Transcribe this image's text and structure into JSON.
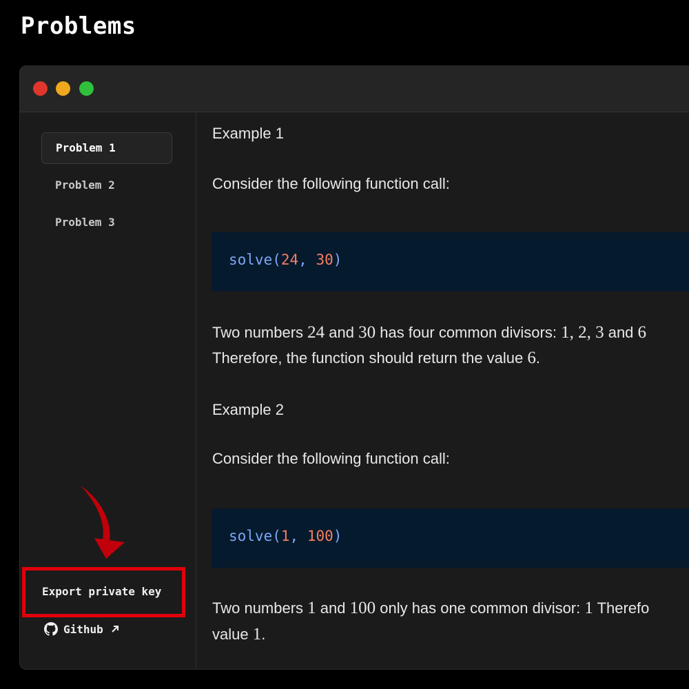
{
  "page": {
    "title": "Problems"
  },
  "sidebar": {
    "items": [
      {
        "label": "Problem 1",
        "active": true
      },
      {
        "label": "Problem 2",
        "active": false
      },
      {
        "label": "Problem 3",
        "active": false
      }
    ],
    "export_label": "Export private key",
    "github_label": "Github"
  },
  "content": {
    "example1": {
      "heading": "Example 1",
      "intro": "Consider the following function call:",
      "code": {
        "fn": "solve",
        "open": "(",
        "arg1": "24",
        "sep": ", ",
        "arg2": "30",
        "close": ")"
      },
      "line1": {
        "a": "Two numbers ",
        "n1": "24",
        "b": " and ",
        "n2": "30",
        "c": " has four common divisors: ",
        "d1": "1",
        "s1": ", ",
        "d2": "2",
        "s2": ", ",
        "d3": "3",
        "e": " and ",
        "d4": "6"
      },
      "line2": {
        "a": "Therefore, the function should return the value ",
        "v": "6",
        "end": "."
      }
    },
    "example2": {
      "heading": "Example 2",
      "intro": "Consider the following function call:",
      "code": {
        "fn": "solve",
        "open": "(",
        "arg1": "1",
        "sep": ", ",
        "arg2": "100",
        "close": ")"
      },
      "line1": {
        "a": "Two numbers ",
        "n1": "1",
        "b": " and ",
        "n2": "100",
        "c": " only has one common divisor: ",
        "d1": "1",
        "e": " Therefo"
      },
      "line2": {
        "a": "value ",
        "v": "1",
        "end": "."
      }
    }
  },
  "colors": {
    "background": "#000000",
    "window": "#1b1b1b",
    "code_bg": "#061a2e",
    "code_fn": "#7fa8f5",
    "code_num": "#f47f62",
    "highlight_box": "#e0000b",
    "arrow": "#c0000a"
  },
  "icons": [
    "github-icon",
    "external-link-icon",
    "red-arrow-annotation"
  ]
}
